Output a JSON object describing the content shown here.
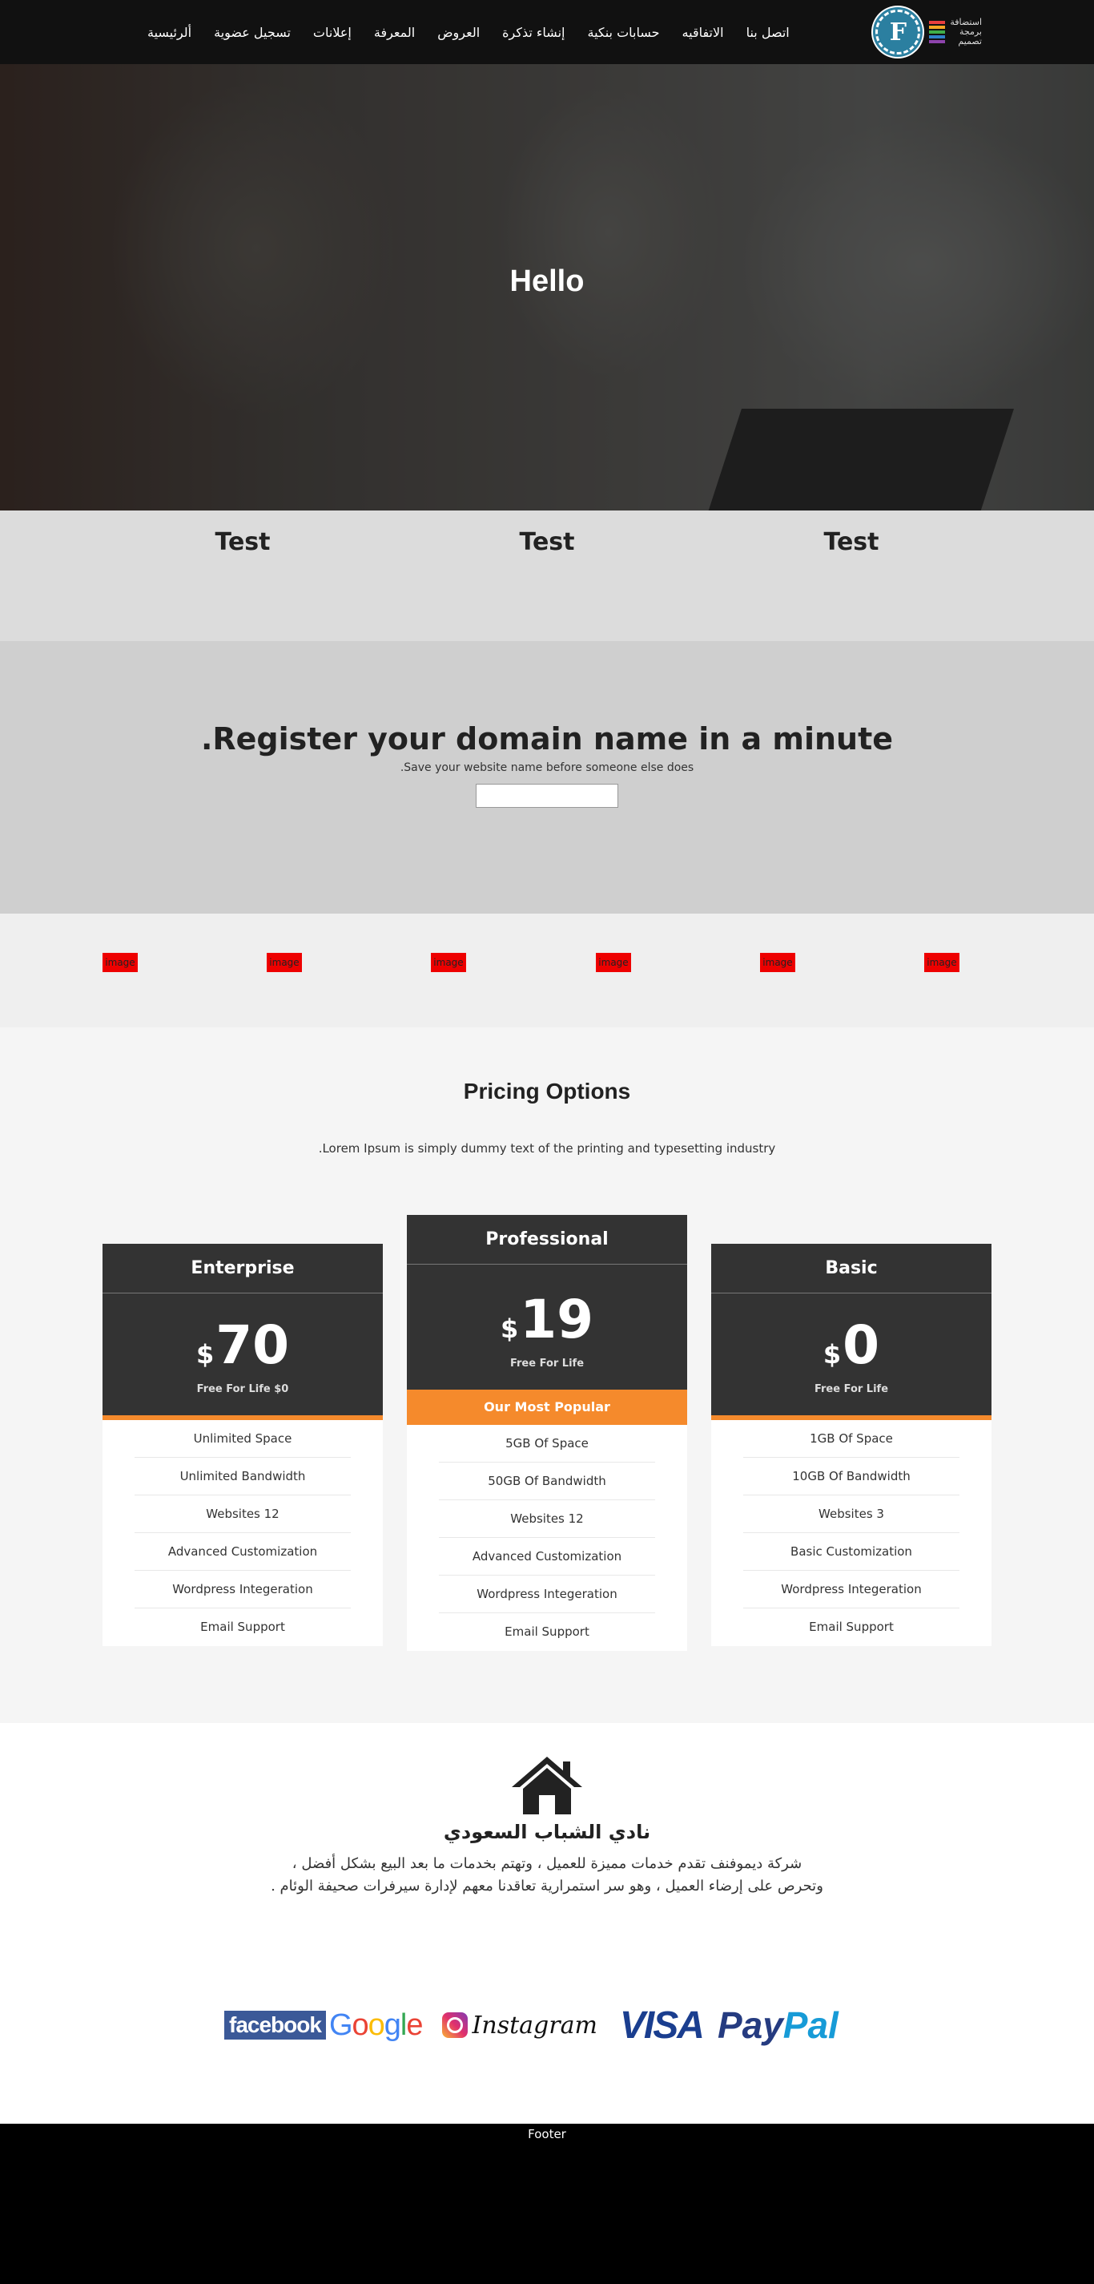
{
  "nav": {
    "items": [
      "ألرئيسية",
      "تسجيل عضوية",
      "إعلانات",
      "المعرفة",
      "العروض",
      "إنشاء تذكرة",
      "حسابات بنكية",
      "الاتفاقيه",
      "اتصل بنا"
    ],
    "brand_letter": "F",
    "brand_text": [
      "استضافة",
      "برمجة",
      "تصميم"
    ],
    "stripe_colors": [
      "#e83e3e",
      "#f5a623",
      "#3fae49",
      "#2f80c8",
      "#8e44ad"
    ]
  },
  "hero": {
    "title": "Hello"
  },
  "tests": [
    "Test",
    "Test",
    "Test"
  ],
  "domain": {
    "title": ".Register your domain name in a minute",
    "subtitle": ".Save your website name before someone else does",
    "input_value": ""
  },
  "logos": {
    "labels": [
      "image",
      "image",
      "image",
      "image",
      "image",
      "image"
    ]
  },
  "pricing": {
    "title": "Pricing Options",
    "subtitle": ".Lorem Ipsum is simply dummy text of the printing and typesetting industry",
    "currency": "$",
    "popular_label": "Our Most Popular",
    "plans": [
      {
        "name": "Enterprise",
        "price": "70",
        "note": "Free For Life $0",
        "features": [
          "Unlimited Space",
          "Unlimited Bandwidth",
          "Websites 12",
          "Advanced Customization",
          "Wordpress Integeration",
          "Email Support"
        ]
      },
      {
        "name": "Professional",
        "price": "19",
        "note": "Free For Life",
        "features": [
          "5GB Of Space",
          "50GB Of Bandwidth",
          "Websites 12",
          "Advanced Customization",
          "Wordpress Integeration",
          "Email Support"
        ]
      },
      {
        "name": "Basic",
        "price": "0",
        "note": "Free For Life",
        "features": [
          "1GB Of Space",
          "10GB Of Bandwidth",
          "Websites 3",
          "Basic Customization",
          "Wordpress Integeration",
          "Email Support"
        ]
      }
    ]
  },
  "about": {
    "title": "نادي الشباب السعودي",
    "line1": "شركة ديموفنف تقدم خدمات مميزة للعميل ، وتهتم بخدمات ما بعد البيع بشكل أفضل ،",
    "line2": "وتحرص على إرضاء العميل ، وهو سر استمرارية تعاقدنا معهم لإدارة سيرفرات صحيفة الوئام ."
  },
  "partners": {
    "facebook": "facebook",
    "google": "Google",
    "instagram": "Instagram",
    "visa": "VISA",
    "paypal_1": "Pay",
    "paypal_2": "Pal"
  },
  "colors": {
    "accent": "#f58a2c",
    "dark": "#333333",
    "nav_bg": "#111111"
  },
  "footer": {
    "text": "Footer"
  }
}
